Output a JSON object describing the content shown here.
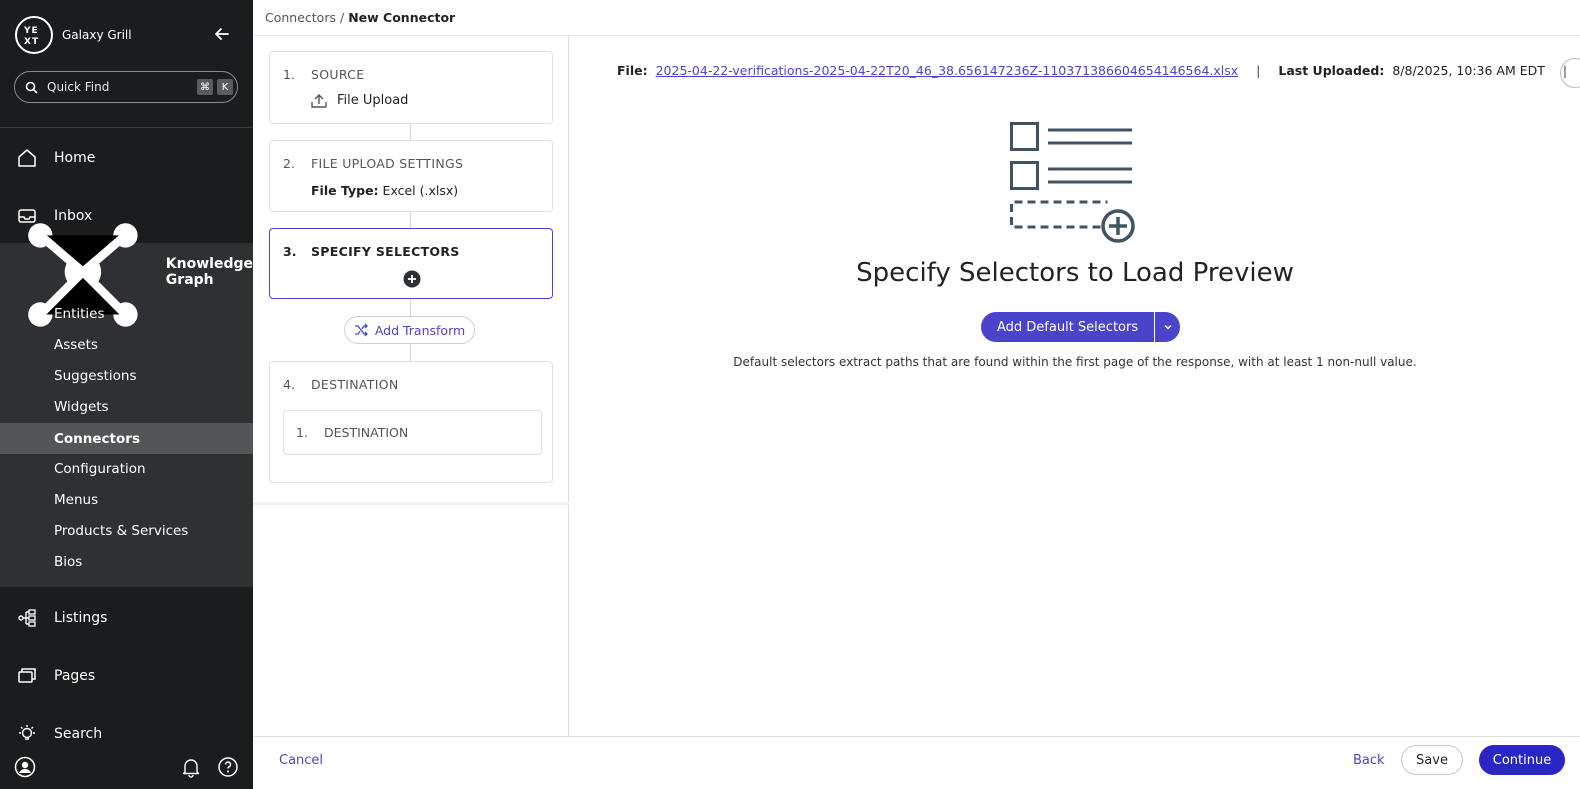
{
  "sidebar": {
    "brand_logo_text": "YEXT",
    "brand_name": "Galaxy Grill",
    "quickfind_label": "Quick Find",
    "quickfind_keys": [
      "⌘",
      "K"
    ],
    "nav": [
      {
        "label": "Home",
        "icon": "home-icon"
      },
      {
        "label": "Inbox",
        "icon": "inbox-icon"
      },
      {
        "label": "Knowledge Graph",
        "icon": "knowledge-graph-icon"
      },
      {
        "label": "Listings",
        "icon": "listings-icon"
      },
      {
        "label": "Pages",
        "icon": "pages-icon"
      },
      {
        "label": "Search",
        "icon": "search-lightbulb-icon"
      }
    ],
    "kg_items": [
      "Entities",
      "Assets",
      "Suggestions",
      "Widgets",
      "Connectors",
      "Configuration",
      "Menus",
      "Products & Services",
      "Bios"
    ],
    "active_item": "Connectors",
    "colors": {
      "background": "#1b1c1e",
      "section": "#2f3033",
      "active": "#545557"
    }
  },
  "breadcrumb": {
    "parent": "Connectors",
    "separator": "/",
    "current": "New Connector"
  },
  "steps": [
    {
      "num": "1.",
      "title": "SOURCE",
      "detail": "File Upload"
    },
    {
      "num": "2.",
      "title": "FILE UPLOAD SETTINGS",
      "detail_label": "File Type:",
      "detail_value": "Excel (.xlsx)"
    },
    {
      "num": "3.",
      "title": "SPECIFY SELECTORS"
    },
    {
      "num": "4.",
      "title": "DESTINATION",
      "inner_num": "1.",
      "inner_title": "DESTINATION"
    }
  ],
  "add_transform_label": "Add Transform",
  "file_info": {
    "file_label": "File:",
    "file_name": "2025-04-22-verifications-2025-04-22T20_46_38.656147236Z-1103713866046541465​64.xlsx",
    "last_uploaded_label": "Last Uploaded:",
    "last_uploaded_value": "8/8/2025, 10:36 AM EDT",
    "separator": "|"
  },
  "preview": {
    "title": "Specify Selectors to Load Preview",
    "button_label": "Add Default Selectors",
    "description": "Default selectors extract paths that are found within the first page of the response, with at least 1 non-null value."
  },
  "footer": {
    "cancel": "Cancel",
    "back": "Back",
    "save": "Save",
    "continue": "Continue"
  },
  "colors": {
    "accent": "#4a44cc",
    "continue": "#2a26c4",
    "illustration": "#3f5566"
  }
}
